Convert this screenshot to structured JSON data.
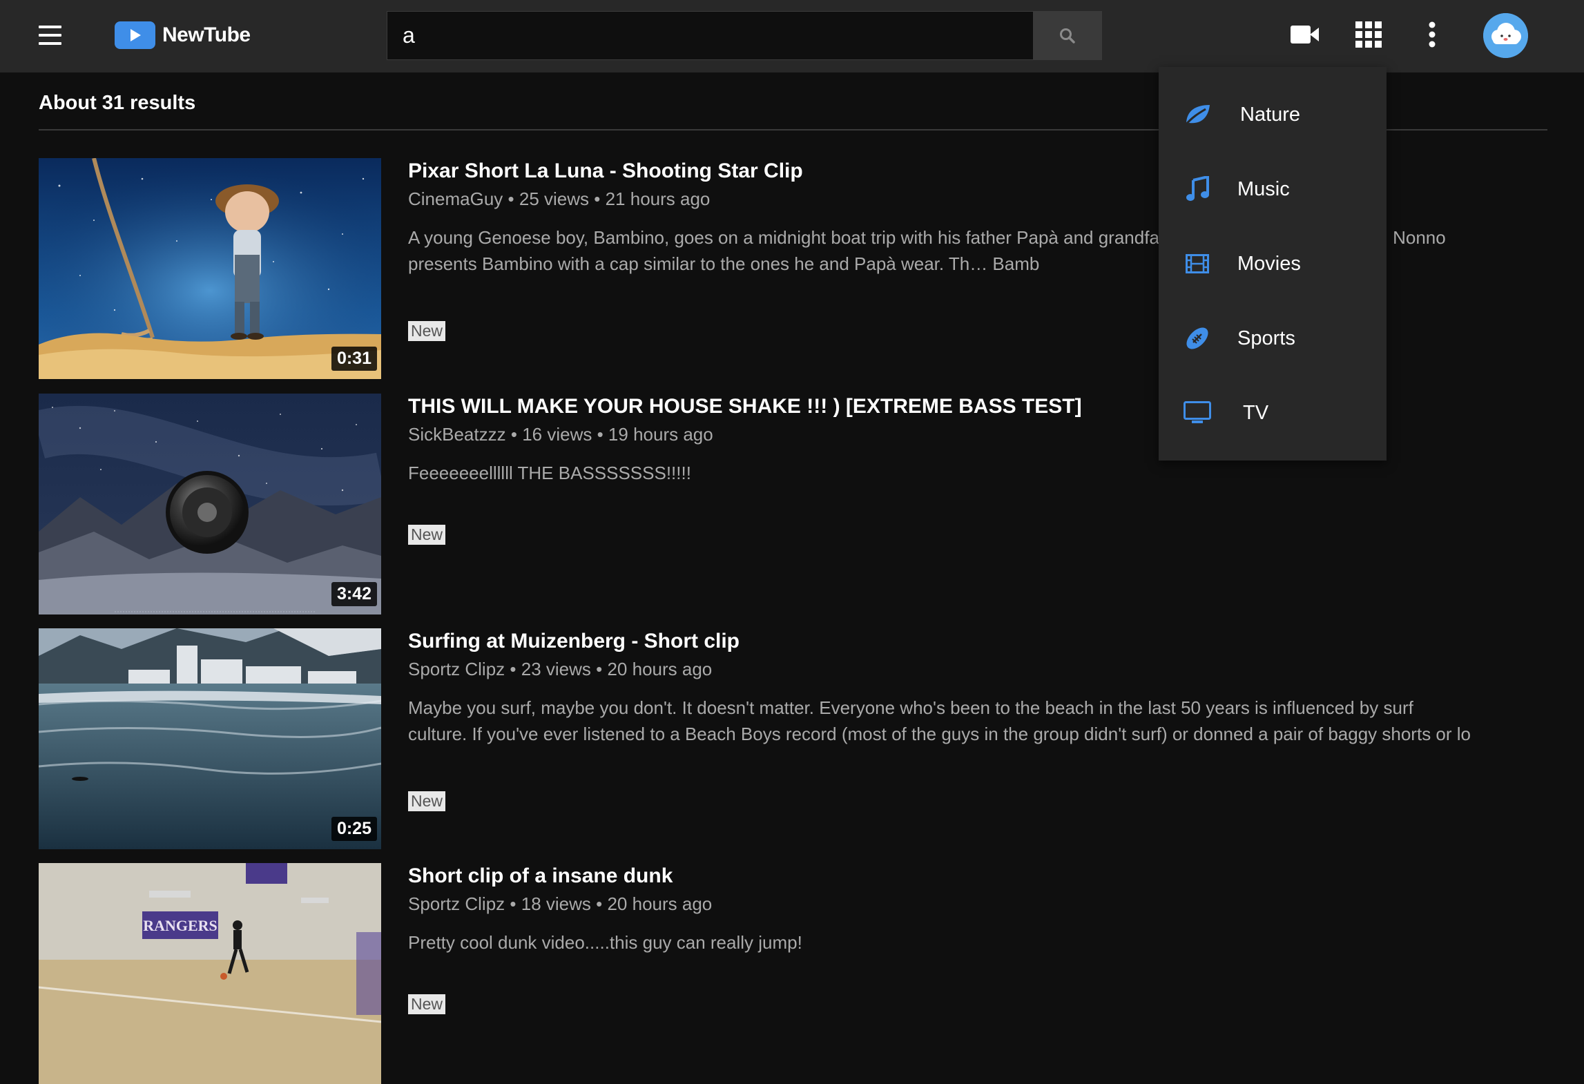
{
  "app": {
    "name": "NewTube",
    "accent_color": "#3f8ee8"
  },
  "header": {
    "menu_icon": "hamburger-menu-icon",
    "search": {
      "value": "a",
      "button_icon": "search-icon"
    },
    "icons": [
      "video-camera-icon",
      "apps-grid-icon",
      "more-vertical-icon",
      "avatar"
    ]
  },
  "results": {
    "summary": "About 31 results",
    "videos": [
      {
        "title": "Pixar Short La Luna - Shooting Star Clip",
        "channel": "CinemaGuy",
        "views": "25 views",
        "age": "21 hours ago",
        "description": "A young Genoese boy, Bambino, goes on a midnight boat trip with his father Papà and grandfath… in the middle of the sea, Nonno presents Bambino with a cap similar to the ones he and Papà wear. Th… Bamb",
        "duration": "0:31",
        "badge": "New"
      },
      {
        "title": "THIS WILL MAKE YOUR HOUSE SHAKE !!! ) [EXTREME BASS TEST]",
        "channel": "SickBeatzzz",
        "views": "16 views",
        "age": "19 hours ago",
        "description": "Feeeeeeellllll THE BASSSSSSS!!!!!",
        "duration": "3:42",
        "badge": "New"
      },
      {
        "title": "Surfing at Muizenberg - Short clip",
        "channel": "Sportz Clipz",
        "views": "23 views",
        "age": "20 hours ago",
        "description": "Maybe you surf, maybe you don't. It doesn't matter. Everyone who's been to the beach in the last 50 years is influenced by surf culture. If you've ever listened to a Beach Boys record (most of the guys in the group didn't surf) or donned a pair of baggy shorts or lo",
        "duration": "0:25",
        "badge": "New"
      },
      {
        "title": "Short clip of a insane dunk",
        "channel": "Sportz Clipz",
        "views": "18 views",
        "age": "20 hours ago",
        "description": "Pretty cool dunk video.....this guy can really jump!",
        "duration": "",
        "badge": "New"
      }
    ]
  },
  "dropdown": {
    "items": [
      {
        "label": "Nature",
        "icon": "leaf-icon"
      },
      {
        "label": "Music",
        "icon": "music-note-icon"
      },
      {
        "label": "Movies",
        "icon": "film-icon"
      },
      {
        "label": "Sports",
        "icon": "football-icon"
      },
      {
        "label": "TV",
        "icon": "tv-icon"
      }
    ]
  },
  "separator": "•"
}
